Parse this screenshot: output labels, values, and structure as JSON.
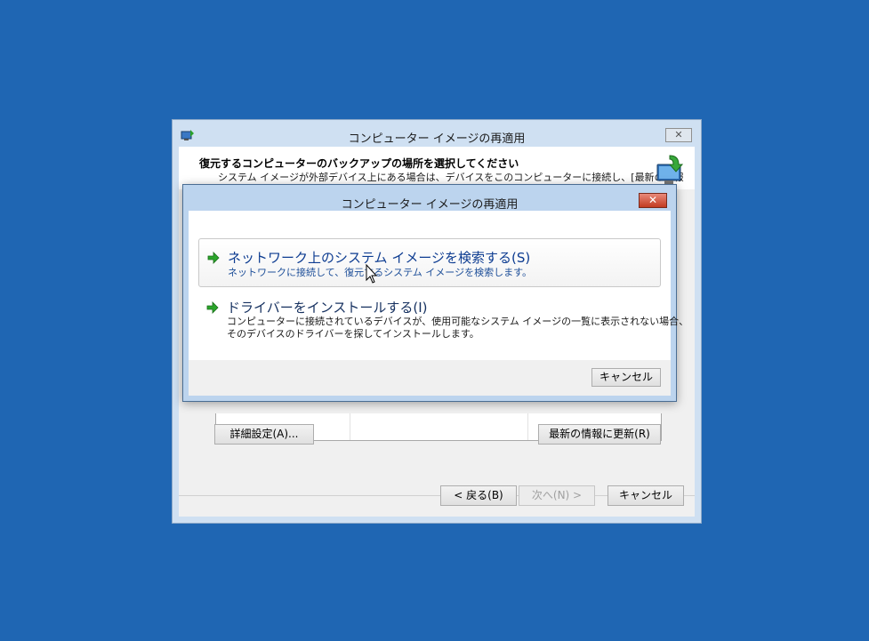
{
  "background_color": "#1f66b3",
  "back_window": {
    "title": "コンピューター イメージの再適用",
    "close_label": "✕",
    "heading": "復元するコンピューターのバックアップの場所を選択してください",
    "subtext": "システム イメージが外部デバイス上にある場合は、デバイスをこのコンピューターに接続し、[最新の情報",
    "advanced_button": "詳細設定(A)...",
    "refresh_button": "最新の情報に更新(R)",
    "back_button": "< 戻る(B)",
    "next_button": "次へ(N) >",
    "cancel_button": "キャンセル"
  },
  "dialog": {
    "title": "コンピューター イメージの再適用",
    "close_label": "✕",
    "options": [
      {
        "label": "ネットワーク上のシステム イメージを検索する(S)",
        "description": [
          "ネットワークに接続して、復元するシステム イメージを検索します。"
        ],
        "icon": "green-arrow-icon"
      },
      {
        "label": "ドライバーをインストールする(I)",
        "description": [
          "コンピューターに接続されているデバイスが、使用可能なシステム イメージの一覧に表示されない場合、",
          "そのデバイスのドライバーを探してインストールします。"
        ],
        "icon": "green-arrow-icon"
      }
    ],
    "cancel_button": "キャンセル"
  }
}
